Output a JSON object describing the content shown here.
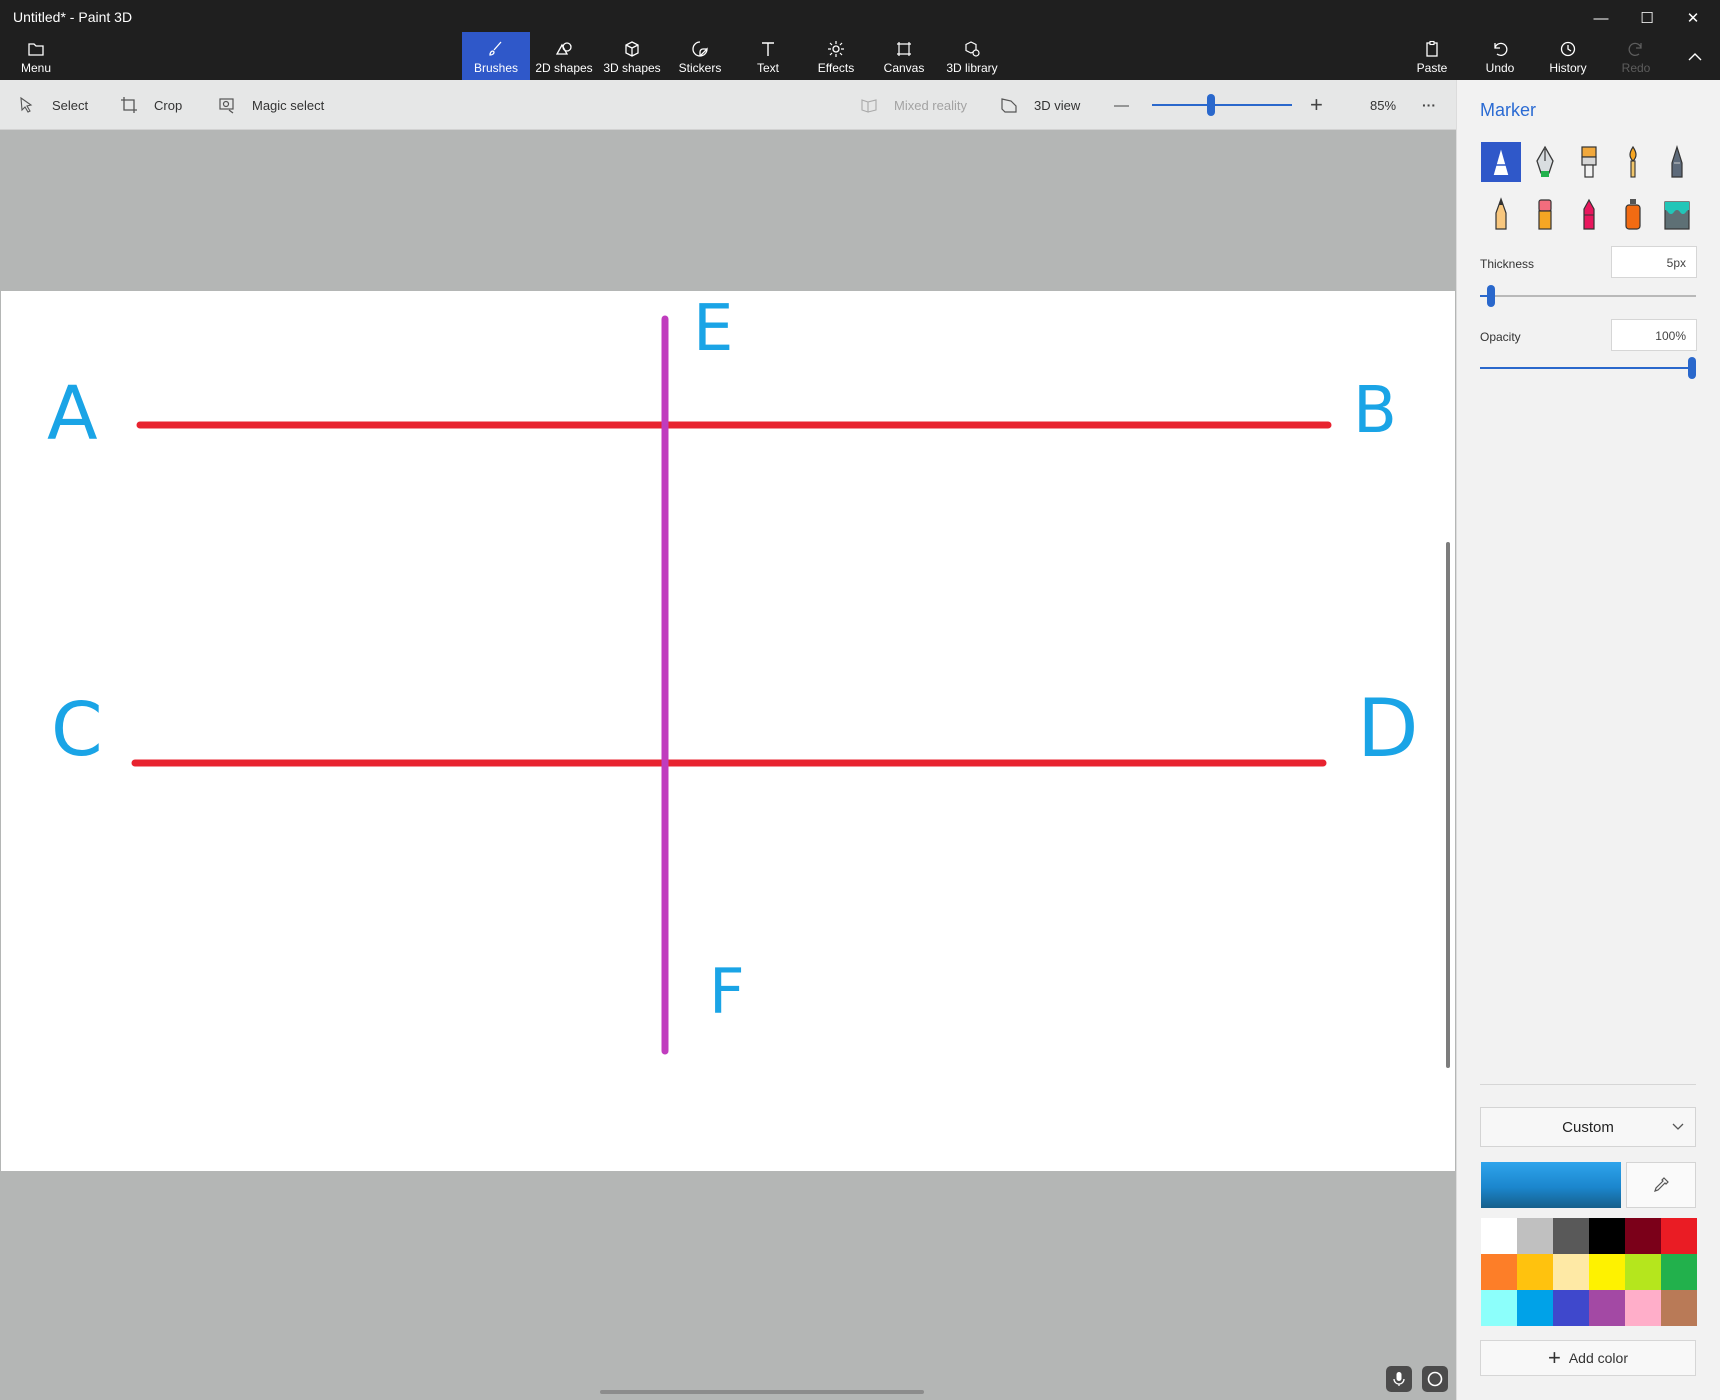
{
  "window": {
    "title": "Untitled* - Paint 3D",
    "minimize_glyph": "—",
    "maximize_glyph": "☐",
    "close_glyph": "✕"
  },
  "ribbon": {
    "menu_label": "Menu",
    "tools": [
      "Brushes",
      "2D shapes",
      "3D shapes",
      "Stickers",
      "Text",
      "Effects",
      "Canvas",
      "3D library"
    ],
    "active_tool": "Brushes",
    "paste_label": "Paste",
    "undo_label": "Undo",
    "history_label": "History",
    "redo_label": "Redo"
  },
  "commandbar": {
    "select_label": "Select",
    "crop_label": "Crop",
    "magic_select_label": "Magic select",
    "mixed_reality_label": "Mixed reality",
    "view3d_label": "3D view",
    "zoom_out_glyph": "—",
    "zoom_in_glyph": "+",
    "zoom_level": "85%",
    "zoom_fraction": 0.42,
    "more_glyph": "···"
  },
  "canvas": {
    "labels": {
      "a": "A",
      "b": "B",
      "c": "C",
      "d": "D",
      "e": "E",
      "f": "F"
    },
    "line_color": "#e8232f",
    "vertical_color": "#c03cbe",
    "label_color": "#1aa4e6"
  },
  "panel": {
    "title": "Marker",
    "brush_icons": [
      "marker-icon",
      "calligraphy-pen-icon",
      "oil-brush-icon",
      "watercolor-icon",
      "pixel-pen-icon",
      "pencil-icon",
      "eraser-icon",
      "crayon-icon",
      "spray-can-icon",
      "fill-icon"
    ],
    "selected_brush": "marker-icon",
    "thickness_label": "Thickness",
    "thickness_value": "5px",
    "thickness_fraction": 0.05,
    "opacity_label": "Opacity",
    "opacity_value": "100%",
    "opacity_fraction": 1.0,
    "color_mode": "Custom",
    "current_color": "#1b8fd8",
    "palette": [
      "#ffffff",
      "#c0c0c0",
      "#595959",
      "#000000",
      "#7b0019",
      "#ea1c24",
      "#fd7e28",
      "#ffc20e",
      "#fee9a5",
      "#fef200",
      "#b5e61d",
      "#22b14c",
      "#8cfffb",
      "#00a2e8",
      "#3f48cc",
      "#a349a4",
      "#ffaec9",
      "#b97a57"
    ],
    "add_color_label": "Add color"
  }
}
